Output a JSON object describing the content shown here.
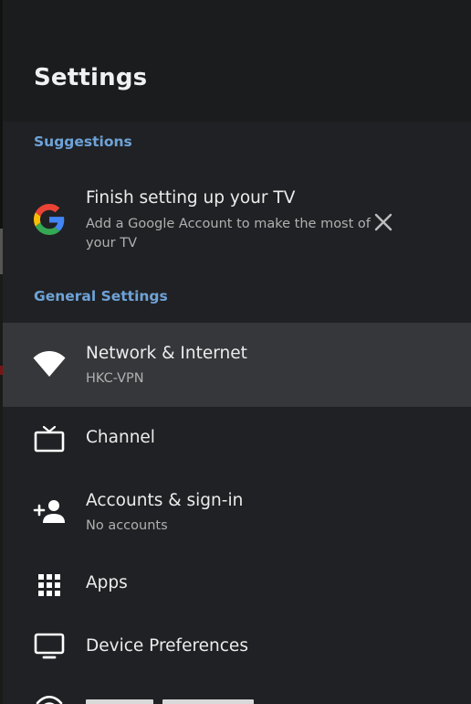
{
  "header": {
    "title": "Settings"
  },
  "suggestions": {
    "heading": "Suggestions",
    "item": {
      "icon": "google-g-icon",
      "title": "Finish setting up your TV",
      "subtitle_line1": "Add a Google Account to make the most of",
      "subtitle_line2": "your TV",
      "dismiss_icon": "close-icon"
    }
  },
  "general": {
    "heading": "General Settings",
    "items": [
      {
        "icon": "wifi-icon",
        "label": "Network & Internet",
        "subtitle": "HKC-VPN",
        "focused": true
      },
      {
        "icon": "tv-icon",
        "label": "Channel"
      },
      {
        "icon": "add-person-icon",
        "label": "Accounts & sign-in",
        "subtitle": "No accounts"
      },
      {
        "icon": "apps-grid-icon",
        "label": "Apps"
      },
      {
        "icon": "monitor-icon",
        "label": "Device Preferences"
      },
      {
        "icon": "remote-accessories-icon"
      }
    ]
  },
  "colors": {
    "panel_bg": "#202124",
    "header_bg": "#1b1c1e",
    "focus_bg": "#35373a",
    "section_heading": "#6ea3d8",
    "primary_text": "#ececec",
    "secondary_text": "#b0b0b0"
  }
}
